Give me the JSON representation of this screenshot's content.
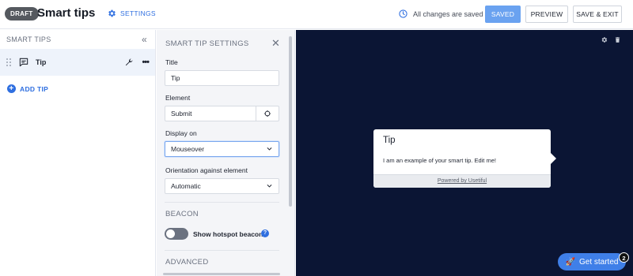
{
  "header": {
    "status_badge": "DRAFT",
    "title": "Smart tips",
    "settings_label": "SETTINGS",
    "save_status": "All changes are saved",
    "buttons": {
      "saved": "SAVED",
      "preview": "PREVIEW",
      "save_exit": "SAVE & EXIT"
    }
  },
  "sidebar": {
    "title": "SMART TIPS",
    "items": [
      {
        "label": "Tip"
      }
    ],
    "add_label": "ADD TIP"
  },
  "settings": {
    "title": "SMART TIP SETTINGS",
    "title_label": "Title",
    "title_value": "Tip",
    "element_label": "Element",
    "element_value": "Submit",
    "display_label": "Display on",
    "display_value": "Mouseover",
    "orientation_label": "Orientation against element",
    "orientation_value": "Automatic",
    "beacon_heading": "BEACON",
    "beacon_toggle_label": "Show hotspot beacon",
    "beacon_enabled": false,
    "advanced_heading": "ADVANCED"
  },
  "preview": {
    "tip_title": "Tip",
    "tip_body": "I am an example of your smart tip. Edit me!",
    "footer": "Powered by Usetiful",
    "get_started_label": "Get started",
    "get_started_count": "2"
  },
  "colors": {
    "accent": "#2f6fe0",
    "canvas_bg": "#0b1534",
    "saved_button": "#6aa2f0",
    "draft_badge": "#55595f"
  },
  "icons": [
    "settings-gear-icon",
    "history-icon",
    "collapse-icon",
    "drag-handle-icon",
    "tip-icon",
    "wrench-icon",
    "more-icon",
    "add-icon",
    "close-icon",
    "target-icon",
    "chevron-down-icon",
    "help-icon",
    "gear-icon",
    "trash-icon",
    "rocket-icon"
  ]
}
